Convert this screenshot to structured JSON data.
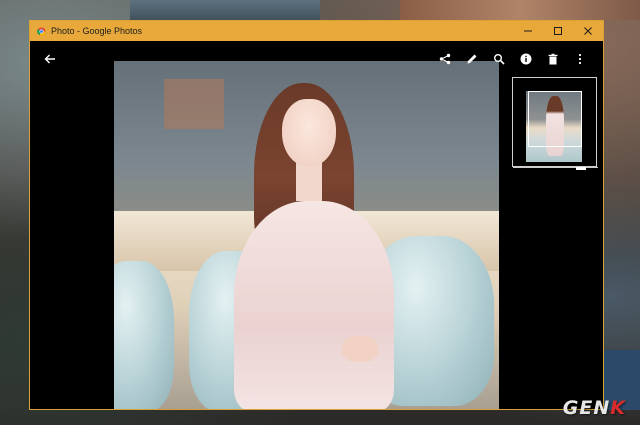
{
  "window": {
    "title": "Photo - Google Photos",
    "accent_color": "#e8a93a"
  },
  "title_controls": {
    "minimize_icon": "minimize-icon",
    "maximize_icon": "maximize-icon",
    "close_icon": "close-icon"
  },
  "viewer": {
    "back_icon": "arrow-left-icon",
    "toolbar_icons": [
      "share-icon",
      "edit-pencil-icon",
      "zoom-icon",
      "info-icon",
      "delete-icon",
      "more-vertical-icon"
    ]
  },
  "watermark": {
    "text_main": "GEN",
    "text_accent": "K",
    "accent_color": "#d82b2b"
  }
}
